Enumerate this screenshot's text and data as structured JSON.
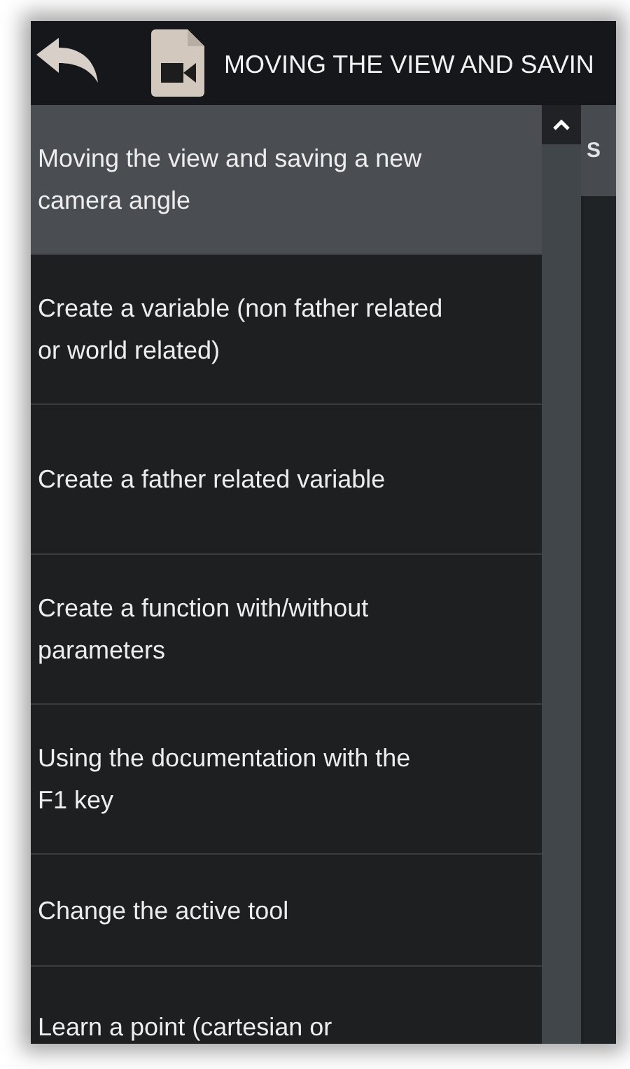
{
  "header": {
    "title": "MOVING THE VIEW AND SAVIN"
  },
  "lessons": [
    {
      "label": "Moving the view and saving a new camera angle",
      "selected": true
    },
    {
      "label": "Create a variable (non father related or world related)",
      "selected": false
    },
    {
      "label": "Create a father related variable",
      "selected": false
    },
    {
      "label": "Create a function with/without parameters",
      "selected": false
    },
    {
      "label": "Using the documentation with the F1 key",
      "selected": false
    },
    {
      "label": "Change the active tool",
      "selected": false
    },
    {
      "label": "Learn a point (cartesian or",
      "selected": false
    }
  ],
  "content_panel": {
    "heading": "S"
  }
}
